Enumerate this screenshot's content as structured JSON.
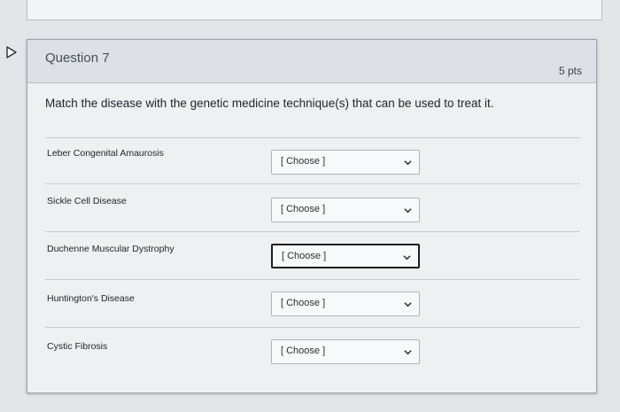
{
  "question": {
    "title": "Question 7",
    "points": "5 pts",
    "prompt": "Match the disease with the genetic medicine technique(s) that can be used to treat it."
  },
  "rows": [
    {
      "label": "Leber Congenital Amaurosis",
      "selected": "[ Choose ]"
    },
    {
      "label": "Sickle Cell Disease",
      "selected": "[ Choose ]"
    },
    {
      "label": "Duchenne Muscular Dystrophy",
      "selected": "[ Choose ]"
    },
    {
      "label": "Huntington's Disease",
      "selected": "[ Choose ]"
    },
    {
      "label": "Cystic Fibrosis",
      "selected": "[ Choose ]"
    }
  ],
  "icons": {
    "flag": "flag-icon",
    "dropdown": "chevron-down-icon"
  }
}
